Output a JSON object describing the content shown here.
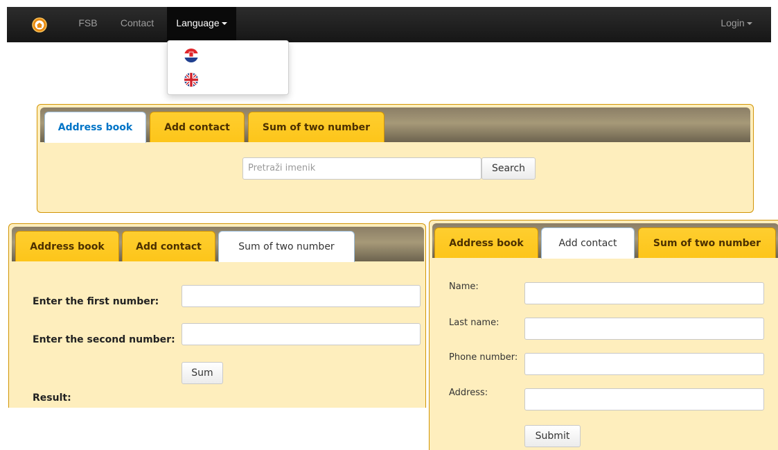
{
  "navbar": {
    "brand_icon": "home-icon",
    "items": [
      {
        "label": "FSB"
      },
      {
        "label": "Contact"
      },
      {
        "label": "Language"
      }
    ],
    "login_label": "Login",
    "colors": {
      "bar": "#1b1b1b",
      "link": "#9d9d9d",
      "active": "#ffffff"
    }
  },
  "language_menu": {
    "options": [
      {
        "icon": "croatia-flag-icon"
      },
      {
        "icon": "uk-flag-icon"
      }
    ]
  },
  "address_widget": {
    "tabs": [
      "Address book",
      "Add contact",
      "Sum of two number"
    ],
    "active_tab": 0,
    "search_placeholder": "Pretraži imenik",
    "search_button": "Search"
  },
  "sum_widget": {
    "tabs": [
      "Address book",
      "Add contact",
      "Sum of two number"
    ],
    "active_tab": 2,
    "first_label": "Enter the first number:",
    "second_label": "Enter the second number:",
    "sum_button": "Sum",
    "result_label": "Result:"
  },
  "contact_widget": {
    "tabs": [
      "Address book",
      "Add contact",
      "Sum of two number"
    ],
    "active_tab": 1,
    "fields": [
      {
        "label": "Name:"
      },
      {
        "label": "Last name:"
      },
      {
        "label": "Phone number:"
      },
      {
        "label": "Address:"
      }
    ],
    "submit_button": "Submit"
  },
  "theme": {
    "panel_bg": "#feeebd",
    "tab_bg": "#fece2f",
    "border": "#d19405",
    "active_tab_text": "#0074c7"
  }
}
